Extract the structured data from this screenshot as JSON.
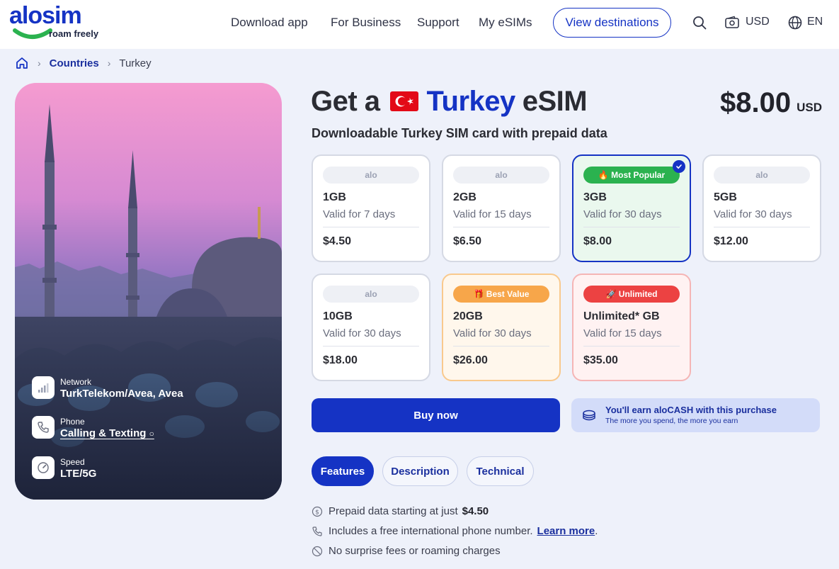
{
  "brand": {
    "name": "alosim",
    "tagline": "roam freely",
    "primary_color": "#1533c4",
    "accent_green": "#2bb24f"
  },
  "header": {
    "nav": [
      "Download app",
      "For Business",
      "Support",
      "My eSIMs"
    ],
    "cta": "View destinations",
    "currency": "USD",
    "language": "EN",
    "icons": [
      "search-icon",
      "wallet-icon",
      "globe-icon"
    ]
  },
  "breadcrumb": {
    "home_icon": "home-icon",
    "link": "Countries",
    "current": "Turkey"
  },
  "hero_specs": [
    {
      "label": "Network",
      "value": "TurkTelekom/Avea, Avea",
      "icon": "signal-icon"
    },
    {
      "label": "Phone",
      "value": "Calling & Texting",
      "icon": "phone-icon"
    },
    {
      "label": "Speed",
      "value": "LTE/5G",
      "icon": "speed-icon"
    }
  ],
  "product": {
    "title_prefix": "Get a",
    "country": "Turkey",
    "title_suffix": "eSIM",
    "price": "$8.00",
    "price_currency": "USD",
    "subtitle": "Downloadable Turkey SIM card with prepaid data"
  },
  "plans": [
    {
      "badge": "alo",
      "data": "1GB",
      "validity": "Valid for 7 days",
      "price": "$4.50"
    },
    {
      "badge": "alo",
      "data": "2GB",
      "validity": "Valid for 15 days",
      "price": "$6.50"
    },
    {
      "badge": "🔥 Most Popular",
      "data": "3GB",
      "validity": "Valid for 30 days",
      "price": "$8.00",
      "selected": true
    },
    {
      "badge": "alo",
      "data": "5GB",
      "validity": "Valid for 30 days",
      "price": "$12.00"
    },
    {
      "badge": "alo",
      "data": "10GB",
      "validity": "Valid for 30 days",
      "price": "$18.00"
    },
    {
      "badge": "🎁 Best Value",
      "data": "20GB",
      "validity": "Valid for 30 days",
      "price": "$26.00"
    },
    {
      "badge": "🚀 Unlimited",
      "data": "Unlimited* GB",
      "validity": "Valid for 15 days",
      "price": "$35.00"
    }
  ],
  "actions": {
    "buy": "Buy now",
    "cash_title": "You'll earn aloCASH with this purchase",
    "cash_sub": "The more you spend, the more you earn"
  },
  "tabs": [
    "Features",
    "Description",
    "Technical"
  ],
  "features": [
    {
      "text": "Prepaid data starting at just",
      "strong": "$4.50"
    },
    {
      "text": "Includes a free international phone number.",
      "link": "Learn more",
      "trail": "."
    },
    {
      "text": "No surprise fees or roaming charges"
    }
  ]
}
